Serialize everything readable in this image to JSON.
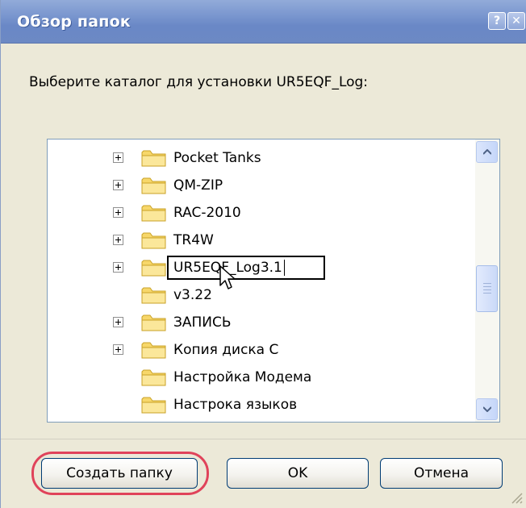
{
  "window": {
    "title": "Обзор папок",
    "help_glyph": "?",
    "close_glyph": "✕"
  },
  "prompt": "Выберите каталог для установки UR5EQF_Log:",
  "tree": {
    "items": [
      {
        "label": "Pocket Tanks",
        "expander": true
      },
      {
        "label": "QM-ZIP",
        "expander": true
      },
      {
        "label": "RAC-2010",
        "expander": true
      },
      {
        "label": "TR4W",
        "expander": true
      },
      {
        "label": "UR5EQF_Log3.1",
        "expander": true,
        "editing": true
      },
      {
        "label": "v3.22",
        "expander": false
      },
      {
        "label": "ЗАПИСЬ",
        "expander": true
      },
      {
        "label": "Копия диска C",
        "expander": true
      },
      {
        "label": "Настройка Модема",
        "expander": false
      },
      {
        "label": "Настрока языков",
        "expander": false
      },
      {
        "label": "",
        "expander": false,
        "partial": true
      }
    ]
  },
  "buttons": {
    "create_folder": "Создать папку",
    "ok": "OK",
    "cancel": "Отмена"
  },
  "colors": {
    "titlebar": "#7b97cf",
    "dialog_bg": "#ece9d8",
    "highlight_ring": "#e0435a",
    "folder_yellow": "#f7d76a"
  }
}
